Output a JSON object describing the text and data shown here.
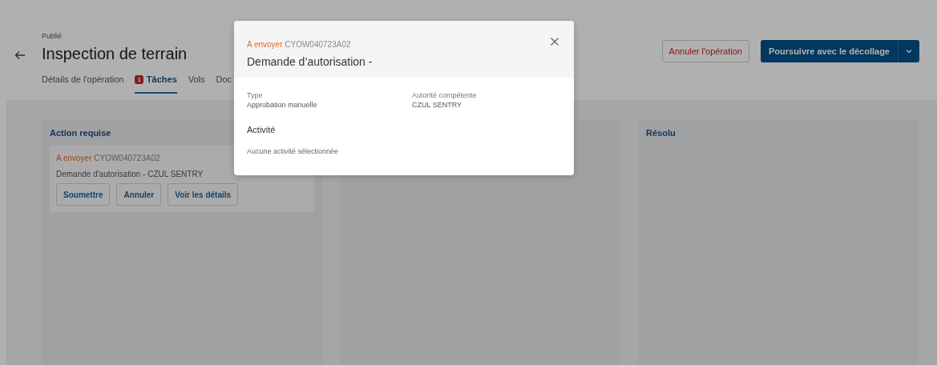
{
  "header": {
    "status": "Publié",
    "title": "Inspection de terrain",
    "actions": [
      {
        "label": "Annuler l'opération",
        "kind": "danger"
      },
      {
        "label": "Poursuivre avec le décollage",
        "kind": "primary"
      }
    ]
  },
  "tabs": [
    {
      "label": "Détails de l'opération",
      "selected": false
    },
    {
      "label": "Tâches",
      "badge": "1",
      "selected": true
    },
    {
      "label": "Vols",
      "selected": false
    },
    {
      "label": "Doc",
      "selected": false
    }
  ],
  "columns": [
    {
      "title": "Action requise",
      "cards": [
        {
          "status": "A envoyer",
          "code": "CYOW040723A02",
          "description": "Demande d'autorisation - CZUL SENTRY",
          "buttons": [
            "Soumettre",
            "Annuler",
            "Voir les détails"
          ]
        }
      ]
    },
    {},
    {
      "title": "Résolu"
    }
  ],
  "modal": {
    "status": "A envoyer",
    "code": "CYOW040723A02",
    "title": "Demande d’autorisation -",
    "fields": [
      {
        "label": "Type",
        "value": "Approbation manuelle"
      },
      {
        "label": "Autorité compétente",
        "value": "CZUL SENTRY"
      }
    ],
    "section_title": "Activité",
    "empty_text": "Aucune activité sélectionnée"
  }
}
